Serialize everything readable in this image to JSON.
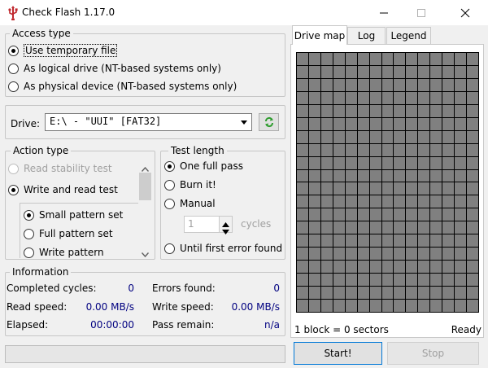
{
  "window": {
    "title": "Check Flash 1.17.0",
    "minimize_glyph": "—",
    "maximize_glyph": "☐",
    "close_glyph": "✕"
  },
  "access_type": {
    "legend": "Access type",
    "options": [
      {
        "label": "Use temporary file",
        "checked": true
      },
      {
        "label": "As logical drive (NT-based systems only)",
        "checked": false
      },
      {
        "label": "As physical device (NT-based systems only)",
        "checked": false
      }
    ]
  },
  "drive": {
    "label": "Drive:",
    "value": "E:\\ - \"UUI\" [FAT32]"
  },
  "action_type": {
    "legend": "Action type",
    "options": [
      {
        "label": "Read stability test",
        "enabled": false
      },
      {
        "label": "Write and read test",
        "checked": true
      }
    ],
    "sub_options": [
      {
        "label": "Small pattern set",
        "checked": true
      },
      {
        "label": "Full pattern set",
        "checked": false
      },
      {
        "label": "Write pattern",
        "checked": false
      }
    ]
  },
  "test_length": {
    "legend": "Test length",
    "options": [
      {
        "label": "One full pass",
        "checked": true
      },
      {
        "label": "Burn it!",
        "checked": false
      },
      {
        "label": "Manual",
        "checked": false
      },
      {
        "label": "Until first error found",
        "checked": false
      }
    ],
    "cycles_value": "1",
    "cycles_label": "cycles"
  },
  "information": {
    "legend": "Information",
    "completed_cycles_label": "Completed cycles:",
    "completed_cycles": "0",
    "errors_found_label": "Errors found:",
    "errors_found": "0",
    "read_speed_label": "Read speed:",
    "read_speed": "0.00 MB/s",
    "write_speed_label": "Write speed:",
    "write_speed": "0.00 MB/s",
    "elapsed_label": "Elapsed:",
    "elapsed": "00:00:00",
    "pass_remain_label": "Pass remain:",
    "pass_remain": "n/a"
  },
  "tabs": [
    {
      "label": "Drive map",
      "active": true
    },
    {
      "label": "Log",
      "active": false
    },
    {
      "label": "Legend",
      "active": false
    }
  ],
  "drive_map": {
    "cell_color": "#808080",
    "grid_line_color": "#000000"
  },
  "status": {
    "block_info": "1 block = 0 sectors",
    "state": "Ready"
  },
  "buttons": {
    "start": "Start!",
    "stop": "Stop"
  }
}
